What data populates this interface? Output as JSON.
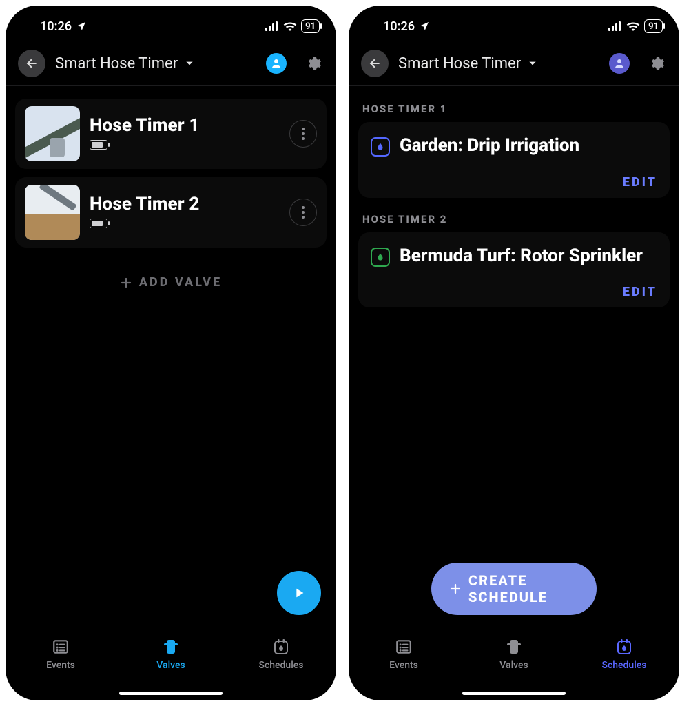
{
  "status": {
    "time": "10:26",
    "battery": "91"
  },
  "header": {
    "title": "Smart Hose Timer"
  },
  "left": {
    "valves": [
      {
        "name": "Hose Timer 1"
      },
      {
        "name": "Hose Timer 2"
      }
    ],
    "add_valve_label": "ADD VALVE",
    "tabs": {
      "events": "Events",
      "valves": "Valves",
      "schedules": "Schedules"
    }
  },
  "right": {
    "sections": [
      {
        "label": "HOSE TIMER 1",
        "title": "Garden: Drip Irrigation",
        "edit": "EDIT"
      },
      {
        "label": "HOSE TIMER 2",
        "title": "Bermuda Turf: Rotor Sprinkler",
        "edit": "EDIT"
      }
    ],
    "create_label": "CREATE SCHEDULE",
    "tabs": {
      "events": "Events",
      "valves": "Valves",
      "schedules": "Schedules"
    }
  }
}
